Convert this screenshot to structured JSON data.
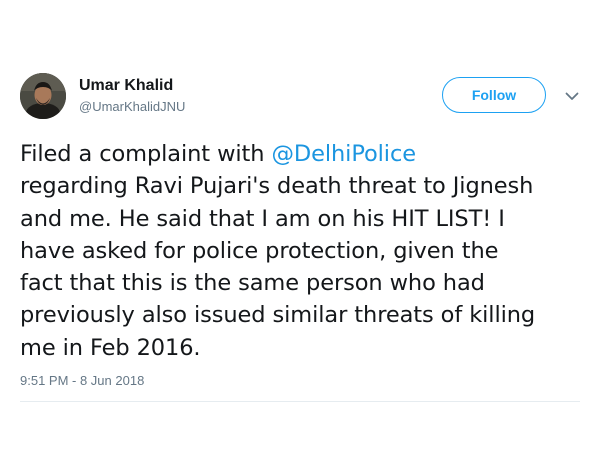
{
  "tweet": {
    "author": {
      "display_name": "Umar Khalid",
      "handle": "@UmarKhalidJNU",
      "avatar_icon": "user-avatar"
    },
    "follow_label": "Follow",
    "menu_icon": "chevron-down-icon",
    "text": {
      "line1_prefix": "Filed a complaint with ",
      "mention": "@DelhiPolice",
      "line2": "regarding Ravi Pujari's death threat to Jignesh",
      "line3": "and me. He said that I am on his HIT LIST! I",
      "line4": "have asked for police protection, given the",
      "line5": "fact that this is the same person who had",
      "line6": "previously also issued similar threats of killing",
      "line7": "me in Feb 2016."
    },
    "timestamp": "9:51 PM - 8 Jun 2018"
  },
  "colors": {
    "accent": "#1da1f2",
    "mention": "#1b95e0",
    "text": "#14171a",
    "secondary_text": "#657786",
    "divider": "#e6ecf0"
  }
}
